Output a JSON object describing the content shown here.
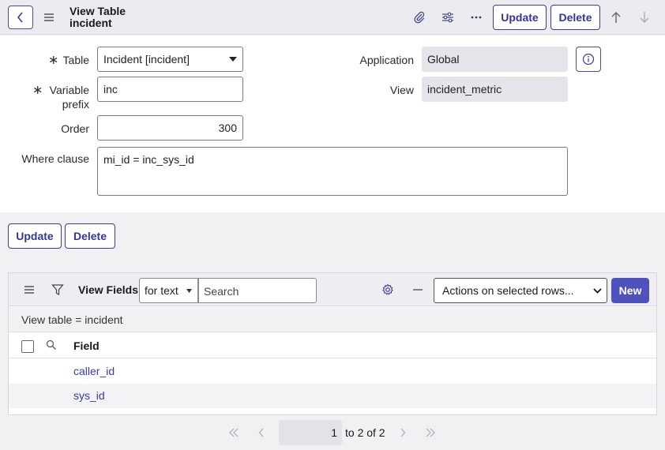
{
  "header": {
    "title_line1": "View Table",
    "title_line2": "incident",
    "update_label": "Update",
    "delete_label": "Delete"
  },
  "form": {
    "table_label": "Table",
    "table_value": "Incident [incident]",
    "variable_prefix_label_1": "Variable",
    "variable_prefix_label_2": "prefix",
    "variable_prefix_value": "inc",
    "order_label": "Order",
    "order_value": "300",
    "where_clause_label": "Where clause",
    "where_clause_value": "mi_id = inc_sys_id",
    "application_label": "Application",
    "application_value": "Global",
    "view_label": "View",
    "view_value": "incident_metric"
  },
  "form_actions": {
    "update_label": "Update",
    "delete_label": "Delete"
  },
  "list": {
    "title": "View Fields",
    "search_type": "for text",
    "search_placeholder": "Search",
    "actions_placeholder": "Actions on selected rows...",
    "new_label": "New",
    "filter_text": "View table = incident",
    "column_field": "Field",
    "rows": [
      {
        "field": "caller_id"
      },
      {
        "field": "sys_id"
      }
    ]
  },
  "pager": {
    "current_page": "1",
    "range_text": "to 2 of 2"
  },
  "colors": {
    "accent": "#3c3c96",
    "primary_button": "#4f52bd",
    "link": "#3a3aa8"
  }
}
